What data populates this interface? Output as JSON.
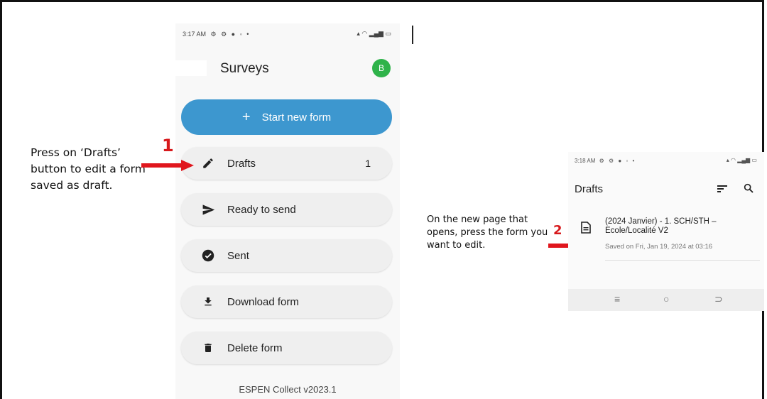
{
  "phone1": {
    "status_time": "3:17 AM",
    "status_right": "⁘ ▾ ▁▃▅ ▮",
    "title": "Surveys",
    "avatar_letter": "B",
    "start_button": "Start new form",
    "menu": [
      {
        "label": "Drafts",
        "count": "1",
        "icon": "pencil-icon"
      },
      {
        "label": "Ready to send",
        "icon": "send-icon"
      },
      {
        "label": "Sent",
        "icon": "check-circle-icon"
      },
      {
        "label": "Download form",
        "icon": "download-icon"
      },
      {
        "label": "Delete form",
        "icon": "trash-icon"
      }
    ],
    "version": "ESPEN Collect v2023.1"
  },
  "annotations": {
    "step1_number": "1",
    "step1_text": "Press on ‘Drafts’ button to edit a form saved as draft.",
    "step2_number": "2",
    "step2_text": "On the new page that opens, press the form you want to edit."
  },
  "phone2": {
    "status_time": "3:18 AM",
    "title": "Drafts",
    "draft_title": "(2024 Janvier) - 1. SCH/STH – Ecole/Localité V2",
    "draft_saved": "Saved on Fri, Jan 19, 2024 at 03:16",
    "nav": [
      "≡",
      "○",
      "⊃"
    ]
  },
  "colors": {
    "primary": "#3d97cf",
    "avatar": "#2fb34a",
    "annotation_red": "#d7191c"
  }
}
